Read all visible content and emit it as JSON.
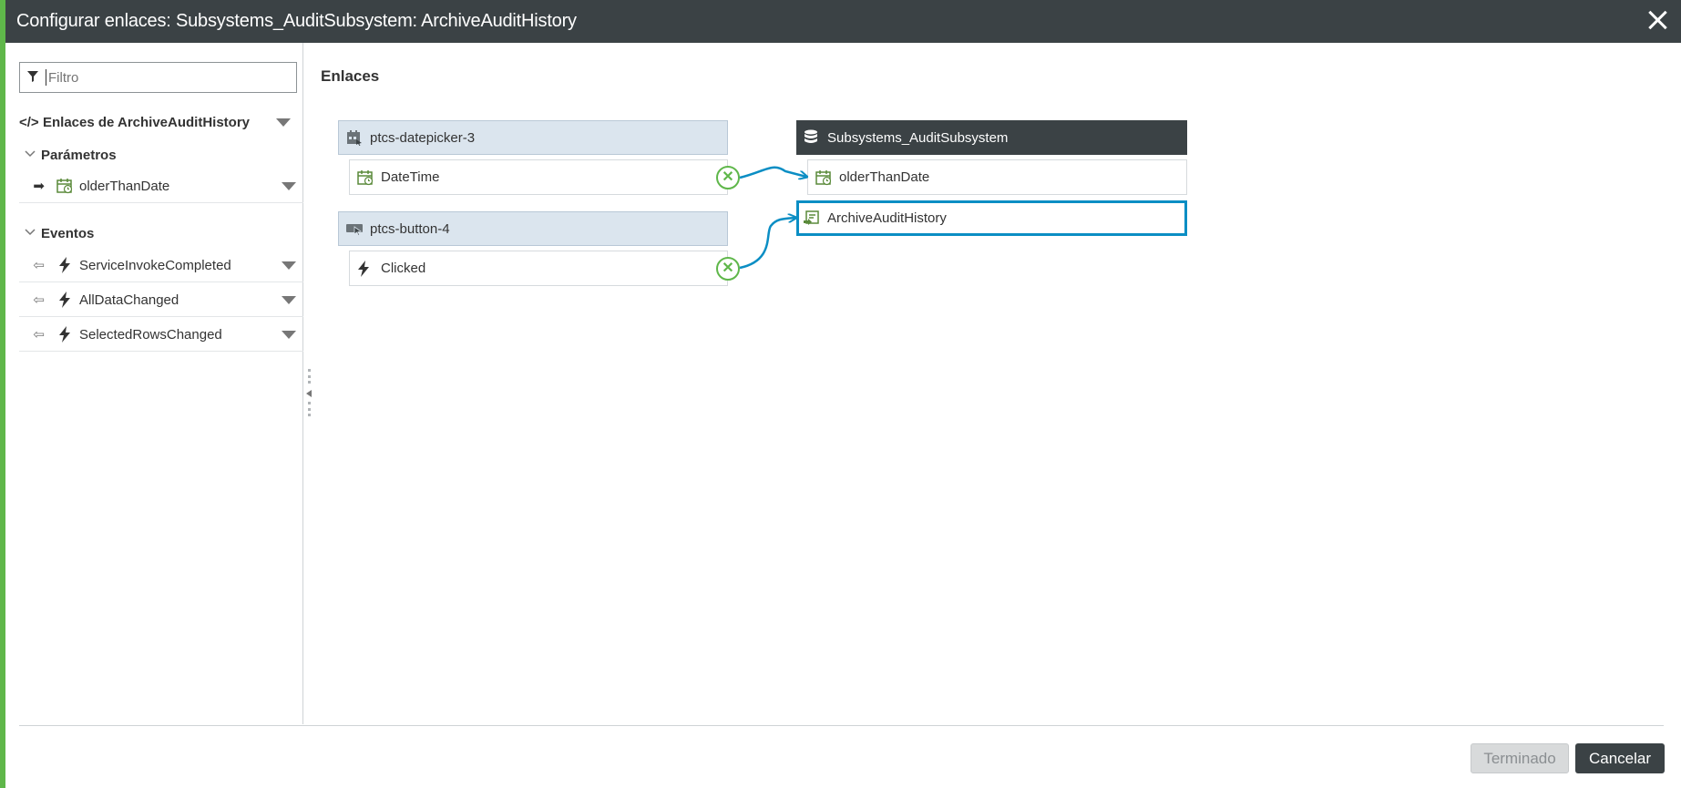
{
  "title": "Configurar enlaces: Subsystems_AuditSubsystem: ArchiveAuditHistory",
  "filter": {
    "placeholder": "Filtro"
  },
  "tree": {
    "heading": "Enlaces de ArchiveAuditHistory",
    "params_label": "Parámetros",
    "params": [
      {
        "label": "olderThanDate"
      }
    ],
    "events_label": "Eventos",
    "events": [
      {
        "label": "ServiceInvokeCompleted"
      },
      {
        "label": "AllDataChanged"
      },
      {
        "label": "SelectedRowsChanged"
      }
    ]
  },
  "main": {
    "title": "Enlaces",
    "sources": [
      {
        "name": "ptcs-datepicker-3",
        "property": "DateTime"
      },
      {
        "name": "ptcs-button-4",
        "property": "Clicked"
      }
    ],
    "target": {
      "name": "Subsystems_AuditSubsystem",
      "items": [
        {
          "label": "olderThanDate"
        },
        {
          "label": "ArchiveAuditHistory"
        }
      ]
    }
  },
  "buttons": {
    "done": "Terminado",
    "cancel": "Cancelar"
  },
  "colors": {
    "accent": "#5fb74a",
    "header": "#3b4245",
    "link": "#0b8ec4",
    "source_bg": "#dbe5ee"
  }
}
